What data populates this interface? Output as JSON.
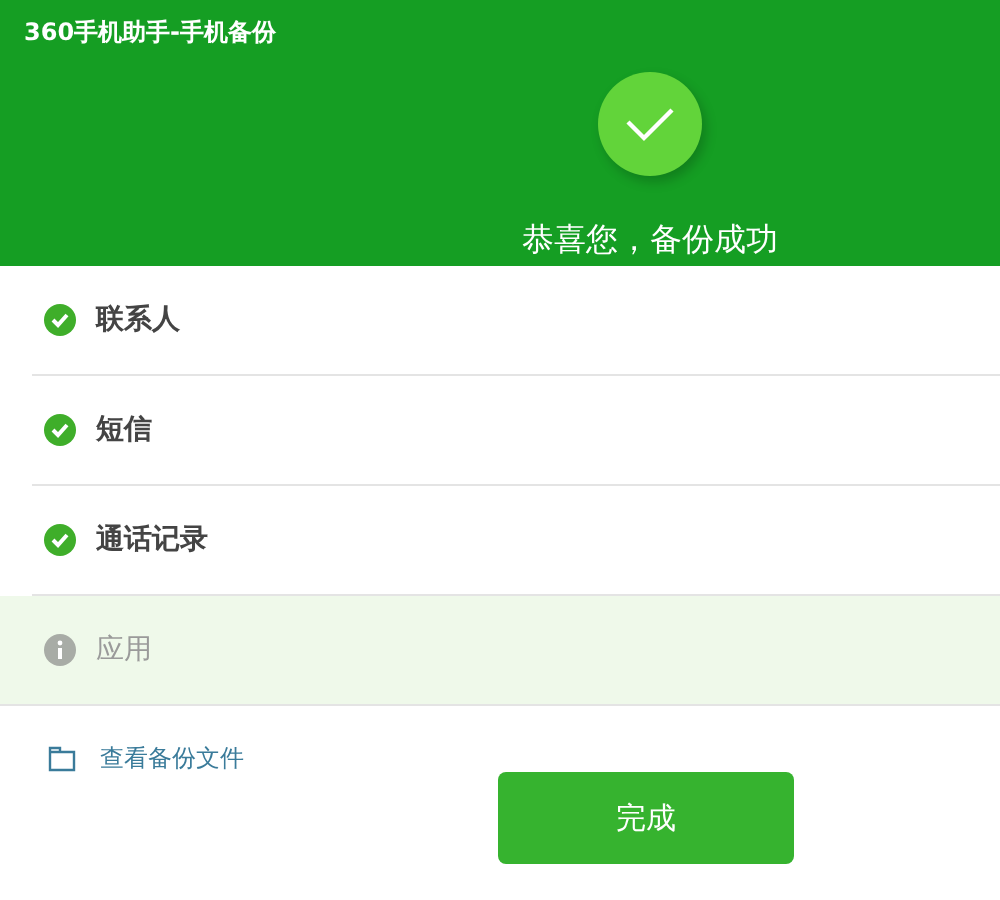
{
  "window": {
    "title": "360手机助手-手机备份"
  },
  "result": {
    "message": "恭喜您，备份成功"
  },
  "items": [
    {
      "label": "联系人",
      "kind": "done"
    },
    {
      "label": "短信",
      "kind": "done"
    },
    {
      "label": "通话记录",
      "kind": "done"
    },
    {
      "label": "应用",
      "kind": "info"
    }
  ],
  "link": {
    "label": "查看备份文件"
  },
  "buttons": [
    {
      "label": "完成"
    }
  ]
}
